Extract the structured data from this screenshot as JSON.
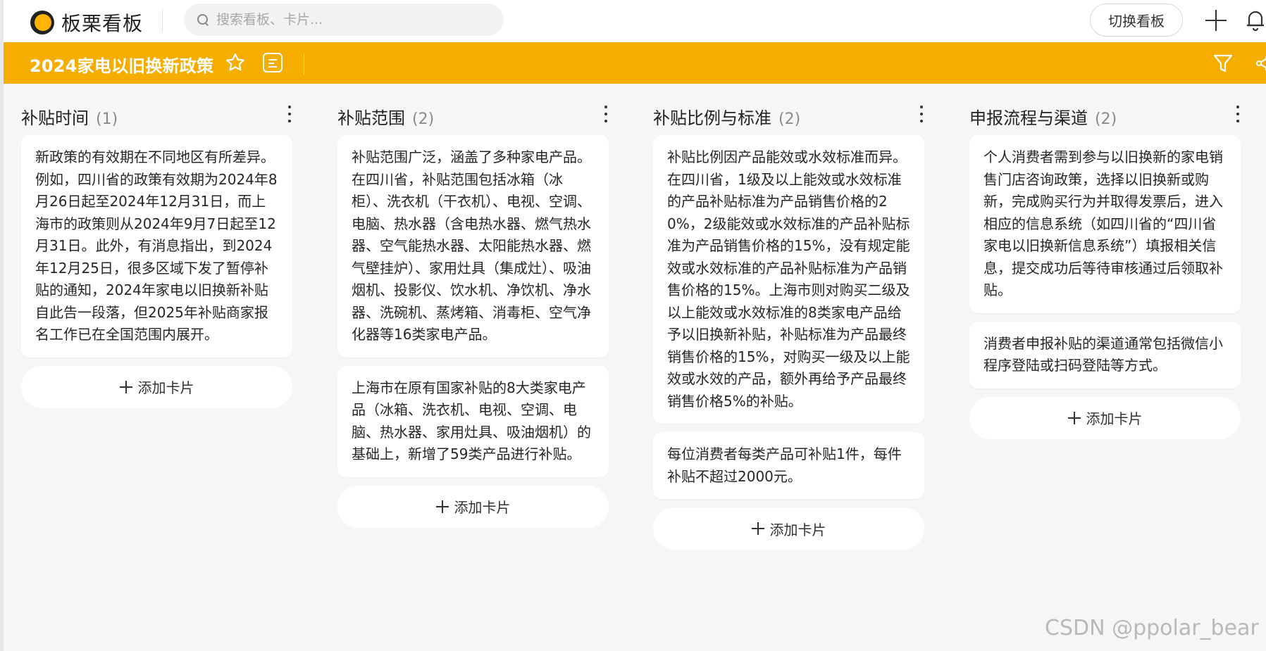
{
  "app": {
    "name": "板栗看板"
  },
  "search": {
    "placeholder": "搜索看板、卡片..."
  },
  "header": {
    "switch_board_label": "切换看板"
  },
  "board": {
    "title": "2024家电以旧换新政策"
  },
  "add_card_label": "添加卡片",
  "columns": [
    {
      "title": "补贴时间",
      "count": "(1)",
      "cards": [
        "新政策的有效期在不同地区有所差异。例如，四川省的政策有效期为2024年8月26日起至2024年12月31日，而上海市的政策则从2024年9月7日起至12月31日。此外，有消息指出，到2024年12月25日，很多区域下发了暂停补贴的通知，2024年家电以旧换新补贴自此告一段落，但2025年补贴商家报名工作已在全国范围内展开。"
      ]
    },
    {
      "title": "补贴范围",
      "count": "(2)",
      "cards": [
        "补贴范围广泛，涵盖了多种家电产品。在四川省，补贴范围包括冰箱（冰柜）、洗衣机（干衣机）、电视、空调、电脑、热水器（含电热水器、燃气热水器、空气能热水器、太阳能热水器、燃气壁挂炉）、家用灶具（集成灶）、吸油烟机、投影仪、饮水机、净饮机、净水器、洗碗机、蒸烤箱、消毒柜、空气净化器等16类家电产品。",
        "上海市在原有国家补贴的8大类家电产品（冰箱、洗衣机、电视、空调、电脑、热水器、家用灶具、吸油烟机）的基础上，新增了59类产品进行补贴。"
      ]
    },
    {
      "title": "补贴比例与标准",
      "count": "(2)",
      "cards": [
        "补贴比例因产品能效或水效标准而异。在四川省，1级及以上能效或水效标准的产品补贴标准为产品销售价格的20%，2级能效或水效标准的产品补贴标准为产品销售价格的15%，没有规定能效或水效标准的产品补贴标准为产品销售价格的15%。上海市则对购买二级及以上能效或水效标准的8类家电产品给予以旧换新补贴，补贴标准为产品最终销售价格的15%，对购买一级及以上能效或水效的产品，额外再给予产品最终销售价格5%的补贴。",
        "每位消费者每类产品可补贴1件，每件补贴不超过2000元。"
      ]
    },
    {
      "title": "申报流程与渠道",
      "count": "(2)",
      "cards": [
        "个人消费者需到参与以旧换新的家电销售门店咨询政策，选择以旧换新或购新，完成购买行为并取得发票后，进入相应的信息系统（如四川省的“四川省家电以旧换新信息系统”）填报相关信息，提交成功后等待审核通过后领取补贴。",
        "消费者申报补贴的渠道通常包括微信小程序登陆或扫码登陆等方式。"
      ]
    }
  ],
  "watermark": "CSDN @ppolar_bear",
  "colors": {
    "accent": "#f5ae00",
    "background": "#f5f6f8",
    "card": "#ffffff"
  }
}
